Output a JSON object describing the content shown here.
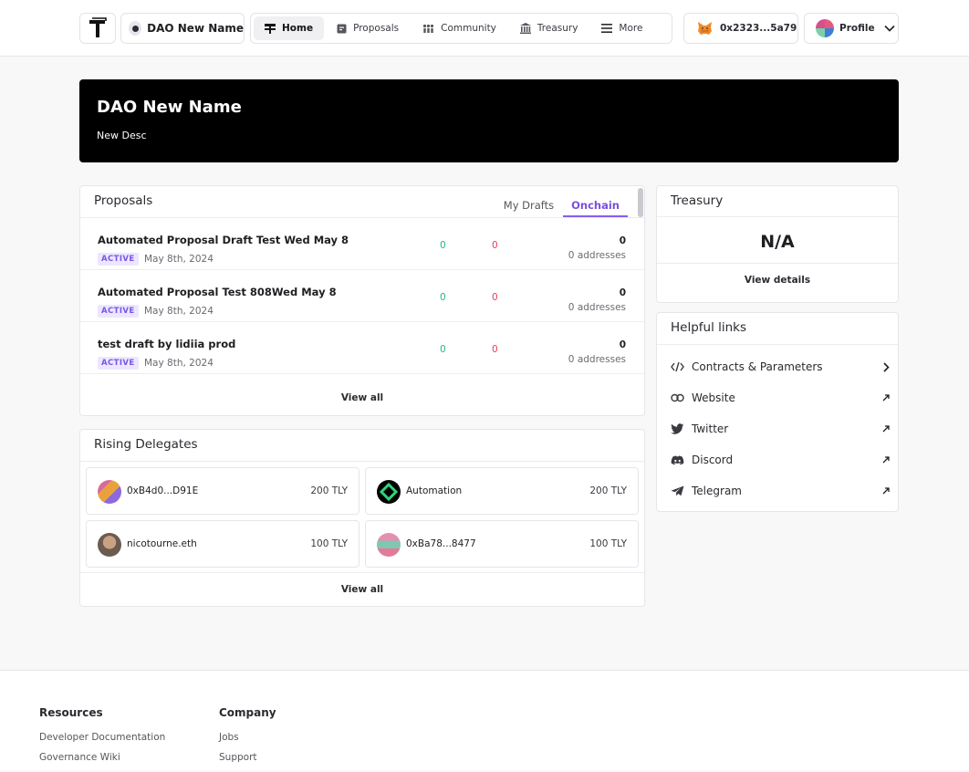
{
  "nav": {
    "dao_name": "DAO New Name",
    "menu": [
      {
        "label": "Home",
        "icon": "home-icon"
      },
      {
        "label": "Proposals",
        "icon": "proposals-icon"
      },
      {
        "label": "Community",
        "icon": "community-icon"
      },
      {
        "label": "Treasury",
        "icon": "treasury-icon"
      },
      {
        "label": "More",
        "icon": "menu-icon"
      }
    ],
    "wallet_address": "0x2323...5a79",
    "profile_label": "Profile"
  },
  "hero": {
    "title": "DAO New Name",
    "description": "New Desc"
  },
  "proposals": {
    "title": "Proposals",
    "tabs": [
      {
        "label": "My Drafts",
        "active": false
      },
      {
        "label": "Onchain",
        "active": true
      }
    ],
    "rows": [
      {
        "name": "Automated Proposal Draft Test Wed May 8",
        "status": "ACTIVE",
        "date": "May 8th, 2024",
        "for": "0",
        "against": "0",
        "votes": "0",
        "addresses": "0 addresses"
      },
      {
        "name": "Automated Proposal Test 808Wed May 8",
        "status": "ACTIVE",
        "date": "May 8th, 2024",
        "for": "0",
        "against": "0",
        "votes": "0",
        "addresses": "0 addresses"
      },
      {
        "name": "test draft by lidiia prod",
        "status": "ACTIVE",
        "date": "May 8th, 2024",
        "for": "0",
        "against": "0",
        "votes": "0",
        "addresses": "0 addresses"
      }
    ],
    "view_all": "View all"
  },
  "delegates": {
    "title": "Rising Delegates",
    "items": [
      {
        "name": "0xB4d0...D91E",
        "amount": "200 TLY"
      },
      {
        "name": "Automation",
        "amount": "200 TLY"
      },
      {
        "name": "nicotourne.eth",
        "amount": "100 TLY"
      },
      {
        "name": "0xBa78...8477",
        "amount": "100 TLY"
      }
    ],
    "view_all": "View all"
  },
  "treasury": {
    "title": "Treasury",
    "value": "N/A",
    "details": "View details"
  },
  "helpful_links": {
    "title": "Helpful links",
    "items": [
      {
        "label": "Contracts & Parameters",
        "icon": "code-icon",
        "action_icon": "chevron-right-icon"
      },
      {
        "label": "Website",
        "icon": "link-icon",
        "action_icon": "external-arrow-icon"
      },
      {
        "label": "Twitter",
        "icon": "twitter-icon",
        "action_icon": "external-arrow-icon"
      },
      {
        "label": "Discord",
        "icon": "discord-icon",
        "action_icon": "external-arrow-icon"
      },
      {
        "label": "Telegram",
        "icon": "telegram-icon",
        "action_icon": "external-arrow-icon"
      }
    ]
  },
  "footer": {
    "resources": {
      "title": "Resources",
      "links": [
        "Developer Documentation",
        "Governance Wiki"
      ]
    },
    "company": {
      "title": "Company",
      "links": [
        "Jobs",
        "Support"
      ]
    }
  },
  "colors": {
    "accent": "#8a5cf0",
    "for": "#1dba84",
    "against": "#e8405a",
    "hero_bg": "#000000"
  }
}
